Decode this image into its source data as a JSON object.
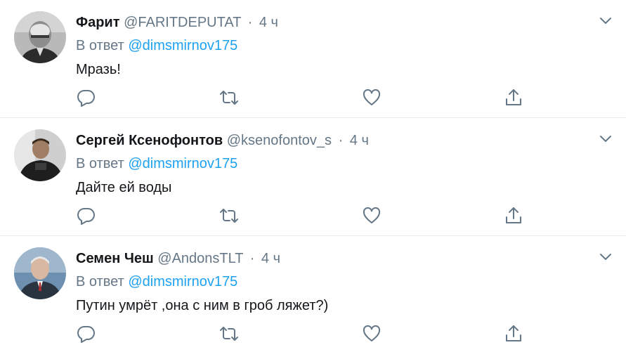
{
  "tweets": [
    {
      "name": "Фарит",
      "handle": "@FARITDEPUTAT",
      "separator": "·",
      "time": "4 ч",
      "reply_prefix": "В ответ",
      "reply_to": "@dimsmirnov175",
      "text": "Мразь!"
    },
    {
      "name": "Сергей Ксенофонтов",
      "handle": "@ksenofontov_s",
      "separator": "·",
      "time": "4 ч",
      "reply_prefix": "В ответ",
      "reply_to": "@dimsmirnov175",
      "text": "Дайте ей воды"
    },
    {
      "name": "Семен Чеш",
      "handle": "@AndonsTLT",
      "separator": "·",
      "time": "4 ч",
      "reply_prefix": "В ответ",
      "reply_to": "@dimsmirnov175",
      "text": "Путин умрёт ,она с ним в гроб ляжет?)"
    }
  ],
  "icons": {
    "menu": "chevron-down-icon",
    "reply": "reply-icon",
    "retweet": "retweet-icon",
    "like": "heart-icon",
    "share": "share-icon"
  },
  "colors": {
    "text": "#14171a",
    "muted": "#657786",
    "link": "#1da1f2",
    "divider": "#e6ecf0"
  }
}
